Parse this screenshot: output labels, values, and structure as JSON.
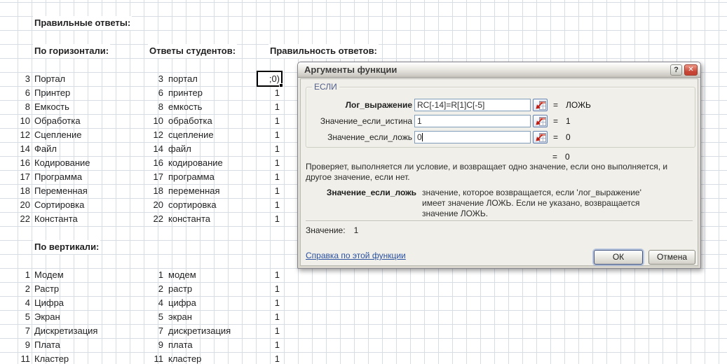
{
  "sheet": {
    "title": "Правильные ответы:",
    "header_horizontal": "По горизонтали:",
    "header_students": "Ответы студентов:",
    "header_correctness": "Правильность ответов:",
    "header_vertical": "По вертикали:",
    "horizontal_rows": [
      {
        "num": "3",
        "word": "Портал",
        "snum": "3",
        "sword": "портал",
        "ok": ";0)",
        "selected": true
      },
      {
        "num": "6",
        "word": "Принтер",
        "snum": "6",
        "sword": "принтер",
        "ok": "1"
      },
      {
        "num": "8",
        "word": "Емкость",
        "snum": "8",
        "sword": "емкость",
        "ok": "1"
      },
      {
        "num": "10",
        "word": "Обработка",
        "snum": "10",
        "sword": "обработка",
        "ok": "1"
      },
      {
        "num": "12",
        "word": "Сцепление",
        "snum": "12",
        "sword": "сцепление",
        "ok": "1"
      },
      {
        "num": "14",
        "word": "Файл",
        "snum": "14",
        "sword": "файл",
        "ok": "1"
      },
      {
        "num": "16",
        "word": "Кодирование",
        "snum": "16",
        "sword": "кодирование",
        "ok": "1"
      },
      {
        "num": "17",
        "word": "Программа",
        "snum": "17",
        "sword": "программа",
        "ok": "1"
      },
      {
        "num": "18",
        "word": "Переменная",
        "snum": "18",
        "sword": "переменная",
        "ok": "1"
      },
      {
        "num": "20",
        "word": "Сортировка",
        "snum": "20",
        "sword": "сортировка",
        "ok": "1"
      },
      {
        "num": "22",
        "word": "Константа",
        "snum": "22",
        "sword": "константа",
        "ok": "1"
      }
    ],
    "vertical_rows": [
      {
        "num": "1",
        "word": "Модем",
        "snum": "1",
        "sword": "модем",
        "ok": "1"
      },
      {
        "num": "2",
        "word": "Растр",
        "snum": "2",
        "sword": "растр",
        "ok": "1"
      },
      {
        "num": "4",
        "word": "Цифра",
        "snum": "4",
        "sword": "цифра",
        "ok": "1"
      },
      {
        "num": "5",
        "word": "Экран",
        "snum": "5",
        "sword": "экран",
        "ok": "1"
      },
      {
        "num": "7",
        "word": "Дискретизация",
        "snum": "7",
        "sword": "дискретизация",
        "ok": "1"
      },
      {
        "num": "9",
        "word": "Плата",
        "snum": "9",
        "sword": "плата",
        "ok": "1"
      },
      {
        "num": "11",
        "word": "Кластер",
        "snum": "11",
        "sword": "кластер",
        "ok": "1"
      }
    ]
  },
  "dialog": {
    "title": "Аргументы функции",
    "help_icon": "?",
    "close_icon": "✕",
    "group_label": "ЕСЛИ",
    "eq": "=",
    "fields": [
      {
        "label": "Лог_выражение",
        "value": "RC[-14]=R[1]C[-5]",
        "result": "ЛОЖЬ"
      },
      {
        "label": "Значение_если_истина",
        "value": "1",
        "result": "1"
      },
      {
        "label": "Значение_если_ложь",
        "value": "0",
        "result": "0"
      }
    ],
    "formula_total": "0",
    "description": "Проверяет, выполняется ли условие, и возвращает одно значение, если оно выполняется, и другое значение, если нет.",
    "arg_term": "Значение_если_ложь",
    "arg_definition": "значение, которое возвращается, если 'лог_выражение' имеет значение ЛОЖЬ. Если не указано, возвращается значение ЛОЖЬ.",
    "value_label": "Значение:",
    "value_result": "1",
    "help_link": "Справка по этой функции",
    "ok_label": "ОК",
    "cancel_label": "Отмена"
  },
  "colors": {
    "close_button": "#c64434",
    "link": "#2a50a0",
    "group_caption": "#53608c",
    "selection_border": "#000000"
  }
}
